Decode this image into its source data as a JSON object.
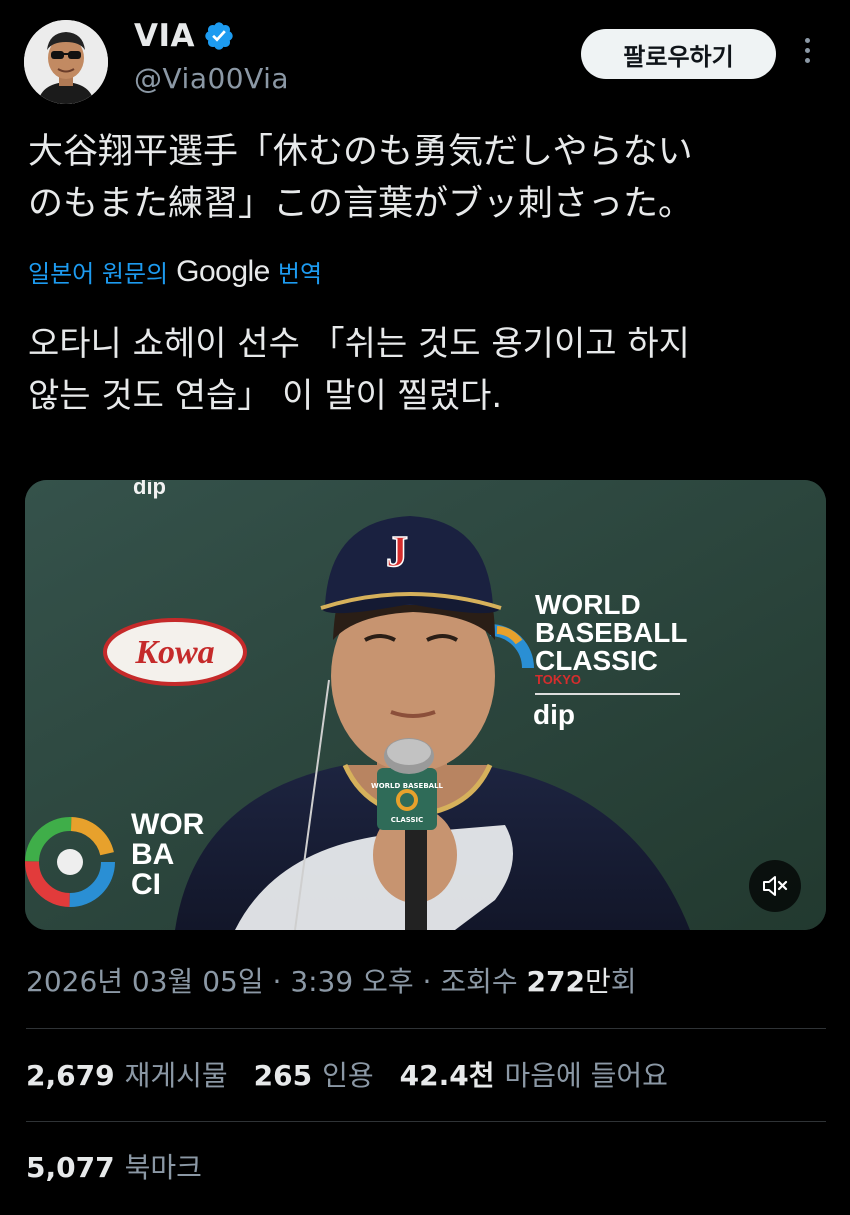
{
  "author": {
    "display_name": "VIA",
    "handle": "@Via00Via",
    "verified": true,
    "avatar_icon": "sunglasses-person-avatar"
  },
  "follow_label": "팔로우하기",
  "more_icon": "more-vertical-icon",
  "tweet": {
    "original_lines": [
      "大谷翔平選手「休むのも勇気だしやらない",
      "のもまた練習」この言葉がブッ刺さった。"
    ],
    "translate_prefix": "일본어 원문의",
    "translate_brand": "Google",
    "translate_suffix": "번역",
    "translated_lines": [
      "오타니 쇼헤이 선수 「쉬는 것도 용기이고 하지",
      "않는 것도 연습」 이 말이 찔렸다."
    ]
  },
  "media": {
    "type": "video",
    "mute_icon": "muted-speaker-icon",
    "backdrop_texts": {
      "top_fragment": "dip",
      "sponsor_logo": "Kowa",
      "wbc_lines": [
        "WORLD",
        "BASEBALL",
        "CLASSIC"
      ],
      "wbc_city": "TOKYO",
      "sponsor2": "dip",
      "wbc_left_lines": [
        "WOR",
        "BA",
        "CI"
      ],
      "cap_letter": "J",
      "mic_flag_lines": [
        "WORLD BASEBALL",
        "CLASSIC"
      ]
    }
  },
  "meta": {
    "date": "2026년 03월 05일",
    "sep1": " · ",
    "time": "3:39 오후",
    "sep2": " · ",
    "views_label": "조회수 ",
    "views_num": "272",
    "views_unit": "만",
    "views_suffix": "회"
  },
  "stats": [
    {
      "num": "2,679",
      "label": "재게시물"
    },
    {
      "num": "265",
      "label": "인용"
    },
    {
      "num": "42.4천",
      "label": "마음에 들어요"
    }
  ],
  "bookmarks": {
    "num": "5,077",
    "label": "북마크"
  },
  "colors": {
    "background": "#000000",
    "text": "#e7e9ea",
    "muted": "#8b98a5",
    "link": "#1d9bf0",
    "verified": "#1d9bf0",
    "divider": "#2f3336"
  }
}
